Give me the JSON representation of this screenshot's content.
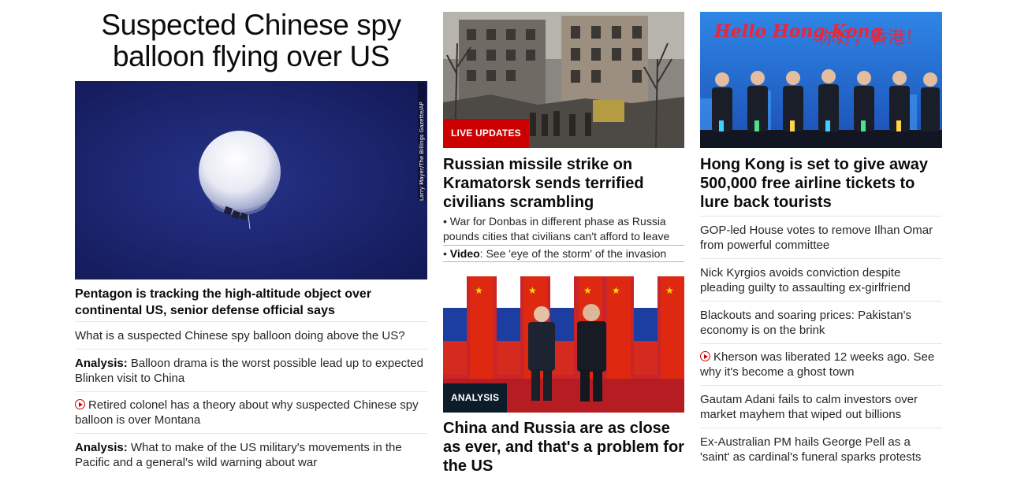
{
  "lead": {
    "title": "Suspected Chinese spy balloon flying over US",
    "image_alt": "balloon-photo",
    "credit": "Larry Mayer/The Billings Gazette/AP",
    "headline": "Pentagon is tracking the high-altitude object over continental US, senior defense official says",
    "related": [
      {
        "prefix": "",
        "text": "What is a suspected Chinese spy balloon doing above the US?",
        "video": false
      },
      {
        "prefix": "Analysis:",
        "text": " Balloon drama is the worst possible lead up to expected Blinken visit to China",
        "video": false
      },
      {
        "prefix": "",
        "text": "Retired colonel has a theory about why suspected Chinese spy balloon is over Montana",
        "video": true
      },
      {
        "prefix": "Analysis:",
        "text": " What to make of the US military's movements in the Pacific and a general's wild warning about war",
        "video": false
      }
    ]
  },
  "ukraine": {
    "badge": "LIVE UPDATES",
    "headline": "Russian missile strike on Kramatorsk sends terrified civilians scrambling",
    "subs": [
      {
        "prefix": "• ",
        "bold": "",
        "text": "War for Donbas in different phase as Russia pounds cities that civilians can't afford to leave"
      },
      {
        "prefix": "• ",
        "bold": "Video",
        "text": ": See 'eye of the storm' of the invasion"
      }
    ]
  },
  "china_russia": {
    "badge": "ANALYSIS",
    "headline": "China and Russia are as close as ever, and that's a problem for the US"
  },
  "hongkong": {
    "sign": "Hello Hong Kong",
    "sign2": "你好，香港！",
    "headline": "Hong Kong is set to give away 500,000 free airline tickets to lure back tourists",
    "list": [
      {
        "text": "GOP-led House votes to remove Ilhan Omar from powerful committee",
        "video": false
      },
      {
        "text": "Nick Kyrgios avoids conviction despite pleading guilty to assaulting ex-girlfriend",
        "video": false
      },
      {
        "text": "Blackouts and soaring prices: Pakistan's economy is on the brink",
        "video": false
      },
      {
        "text": "Kherson was liberated 12 weeks ago. See why it's become a ghost town",
        "video": true
      },
      {
        "text": "Gautam Adani fails to calm investors over market mayhem that wiped out billions",
        "video": false
      },
      {
        "text": "Ex-Australian PM hails George Pell as a 'saint' as cardinal's funeral sparks protests",
        "video": false
      }
    ]
  },
  "colors": {
    "accent_red": "#cc0000",
    "analysis_badge": "#0c1c2a",
    "balloon_sky": "#1a2470"
  }
}
